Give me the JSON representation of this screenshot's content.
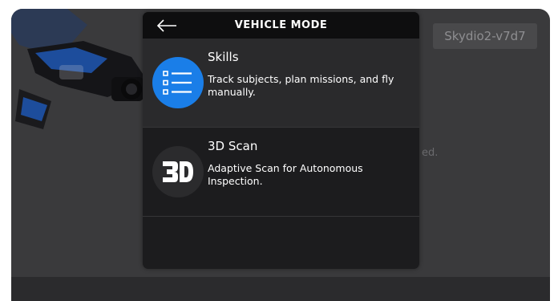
{
  "header": {
    "title": "VEHICLE MODE"
  },
  "device": {
    "name": "Skydio2-v7d7",
    "background_text": "ed."
  },
  "modes": [
    {
      "name": "Skills",
      "description": "Track subjects, plan missions, and fly manually.",
      "icon": "list-icon",
      "icon_bg": "#1a7ee8",
      "selected": true
    },
    {
      "name": "3D Scan",
      "description": "Adaptive Scan for Autonomous Inspection.",
      "icon": "3d-scan-icon",
      "icon_bg": "#2b2b2d",
      "selected": false
    }
  ],
  "colors": {
    "accent": "#1a7ee8",
    "modal_bg": "#1c1c1e",
    "header_bg": "#0e0e0f"
  }
}
